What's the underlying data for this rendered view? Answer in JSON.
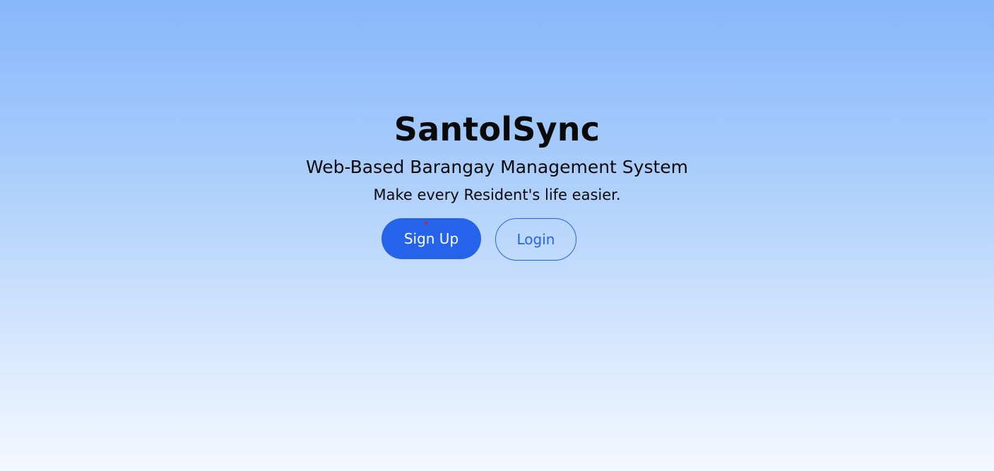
{
  "app": {
    "title": "SantolSync",
    "subtitle": "Web-Based Barangay Management System",
    "tagline": "Make every Resident's life easier."
  },
  "actions": {
    "signup_label": "Sign Up",
    "login_label": "Login"
  },
  "colors": {
    "accent": "#2563eb",
    "background_top": "#86b7fb",
    "background_bottom": "#f4f8ff",
    "text": "#0a0a0a"
  }
}
